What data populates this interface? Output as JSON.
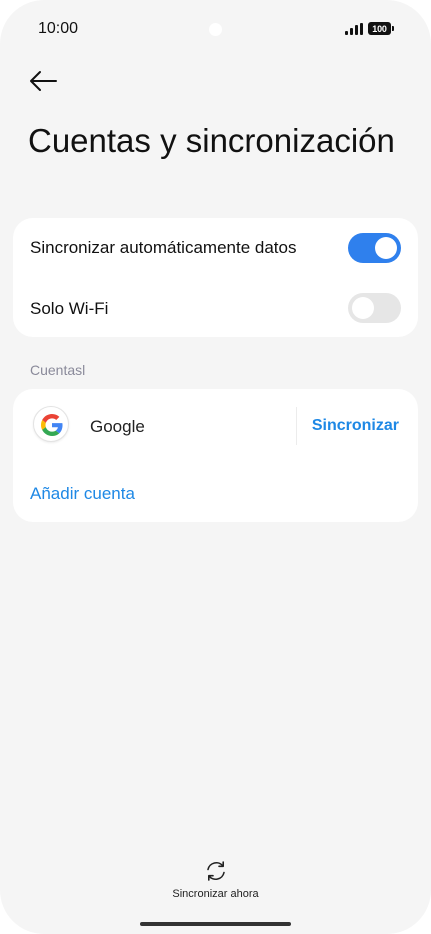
{
  "status_bar": {
    "time": "10:00",
    "battery": "100"
  },
  "header": {
    "title": "Cuentas y sincronización"
  },
  "settings": {
    "auto_sync": {
      "label": "Sincronizar automáticamente datos",
      "enabled": true
    },
    "wifi_only": {
      "label": "Solo Wi-Fi",
      "enabled": false
    }
  },
  "accounts_section": {
    "label": "Cuentasl",
    "accounts": [
      {
        "name": "Google",
        "icon": "google-logo-icon",
        "action": "Sincronizar"
      }
    ],
    "add_account": "Añadir cuenta"
  },
  "bottom": {
    "sync_now": "Sincronizar ahora"
  },
  "colors": {
    "accent": "#1e88e5",
    "toggle_on": "#2f80ed",
    "toggle_off": "#e6e6e6",
    "background": "#f5f5f5"
  }
}
